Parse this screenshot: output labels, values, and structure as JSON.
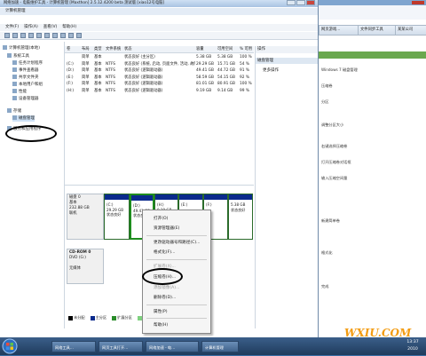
{
  "background": {
    "tab1": "网页游戏…",
    "tab2": "文件同步工具",
    "tab3": "某某公司",
    "lines": [
      "Windows 7 磁盘管理",
      "压缩卷",
      "分区",
      "调整分区大小",
      "右键选择压缩卷",
      "打开压缩卷对话框",
      "输入压缩空间量",
      "新建简单卷",
      "格式化",
      "完成"
    ],
    "logo": "WXIU.COM"
  },
  "window": {
    "title": "网络加速 - 电脑维护工具 - 计算机管理 [Maxthon] 2.5.12.4200 beta 测试版 [xiao12号电脑]",
    "subtitle": "计算机管理"
  },
  "menu": [
    "文件(F)",
    "操作(A)",
    "查看(V)",
    "帮助(H)"
  ],
  "tree": {
    "root": "计算机管理(本地)",
    "items": [
      {
        "label": "系统工具"
      },
      {
        "label": "任务计划程序"
      },
      {
        "label": "事件查看器"
      },
      {
        "label": "共享文件夹"
      },
      {
        "label": "本地用户和组"
      },
      {
        "label": "性能"
      },
      {
        "label": "设备管理器"
      },
      {
        "label": "存储"
      },
      {
        "label": "磁盘管理"
      },
      {
        "label": "服务和应用程序"
      }
    ]
  },
  "volumes": {
    "headers": [
      "卷",
      "布局",
      "类型",
      "文件系统",
      "状态",
      "容量",
      "可用空间",
      "% 可用"
    ],
    "rows": [
      {
        "vol": "",
        "layout": "简单",
        "type": "基本",
        "fs": "",
        "status": "状态良好 (主分区)",
        "cap": "5.38 GB",
        "free": "5.38 GB",
        "pct": "100 %"
      },
      {
        "vol": "(C:)",
        "layout": "简单",
        "type": "基本",
        "fs": "NTFS",
        "status": "状态良好 (系统, 启动, 页面文件, 活动, 故障转储, 主分区)",
        "cap": "29.29 GB",
        "free": "15.71 GB",
        "pct": "54 %"
      },
      {
        "vol": "(D:)",
        "layout": "简单",
        "type": "基本",
        "fs": "NTFS",
        "status": "状态良好 (逻辑驱动器)",
        "cap": "49.41 GB",
        "free": "44.72 GB",
        "pct": "91 %"
      },
      {
        "vol": "(E:)",
        "layout": "简单",
        "type": "基本",
        "fs": "NTFS",
        "status": "状态良好 (逻辑驱动器)",
        "cap": "58.59 GB",
        "free": "54.15 GB",
        "pct": "92 %"
      },
      {
        "vol": "(F:)",
        "layout": "简单",
        "type": "基本",
        "fs": "NTFS",
        "status": "状态良好 (逻辑驱动器)",
        "cap": "81.01 GB",
        "free": "80.91 GB",
        "pct": "100 %"
      },
      {
        "vol": "(H:)",
        "layout": "简单",
        "type": "基本",
        "fs": "NTFS",
        "status": "状态良好 (逻辑驱动器)",
        "cap": "9.19 GB",
        "free": "9.14 GB",
        "pct": "99 %"
      }
    ]
  },
  "actions": {
    "header": "操作",
    "section": "磁盘管理",
    "more": "更多操作"
  },
  "disks": {
    "disk0": {
      "name": "磁盘 0",
      "type": "基本",
      "size": "232.88 GB",
      "status": "联机"
    },
    "cdrom": {
      "name": "CD-ROM 0",
      "type": "DVD (G:)",
      "status": "无媒体"
    },
    "partitions": [
      {
        "title": "(C:)",
        "size": "29.29 GB",
        "status": "状态良好"
      },
      {
        "title": "(D:)",
        "size": "49.41 GB",
        "status": "状态良好"
      },
      {
        "title": "(H:)",
        "size": "9.19 GB",
        "status": "状态良好"
      },
      {
        "title": "(E:)",
        "size": "",
        "status": ""
      },
      {
        "title": "(F:)",
        "size": "",
        "status": ""
      },
      {
        "title": "",
        "size": "5.38 GB",
        "status": "状态良好"
      }
    ]
  },
  "legend": [
    {
      "label": "未分配",
      "color": "#000000"
    },
    {
      "label": "主分区",
      "color": "#0a2a8c"
    },
    {
      "label": "扩展分区",
      "color": "#2a8c2a"
    },
    {
      "label": "可用空间",
      "color": "#7fd17f"
    },
    {
      "label": "逻辑驱动器",
      "color": "#3b5fc2"
    }
  ],
  "context_menu": [
    {
      "label": "打开(O)",
      "disabled": false
    },
    {
      "label": "资源管理器(E)",
      "disabled": false
    },
    {
      "label": "更改驱动器号和路径(C)...",
      "disabled": false
    },
    {
      "label": "格式化(F)...",
      "disabled": false
    },
    {
      "label": "扩展卷(X)...",
      "disabled": true
    },
    {
      "label": "压缩卷(H)...",
      "disabled": false
    },
    {
      "label": "添加镜像(A)...",
      "disabled": true
    },
    {
      "label": "删除卷(D)...",
      "disabled": false
    },
    {
      "label": "属性(P)",
      "disabled": false
    },
    {
      "label": "帮助(H)",
      "disabled": false
    }
  ],
  "taskbar": {
    "apps": [
      "网络工具…",
      "网页工具打开…",
      "网络加速 - 电…",
      "计算机管理"
    ],
    "clock_time": "13:37",
    "clock_date": "2010"
  }
}
